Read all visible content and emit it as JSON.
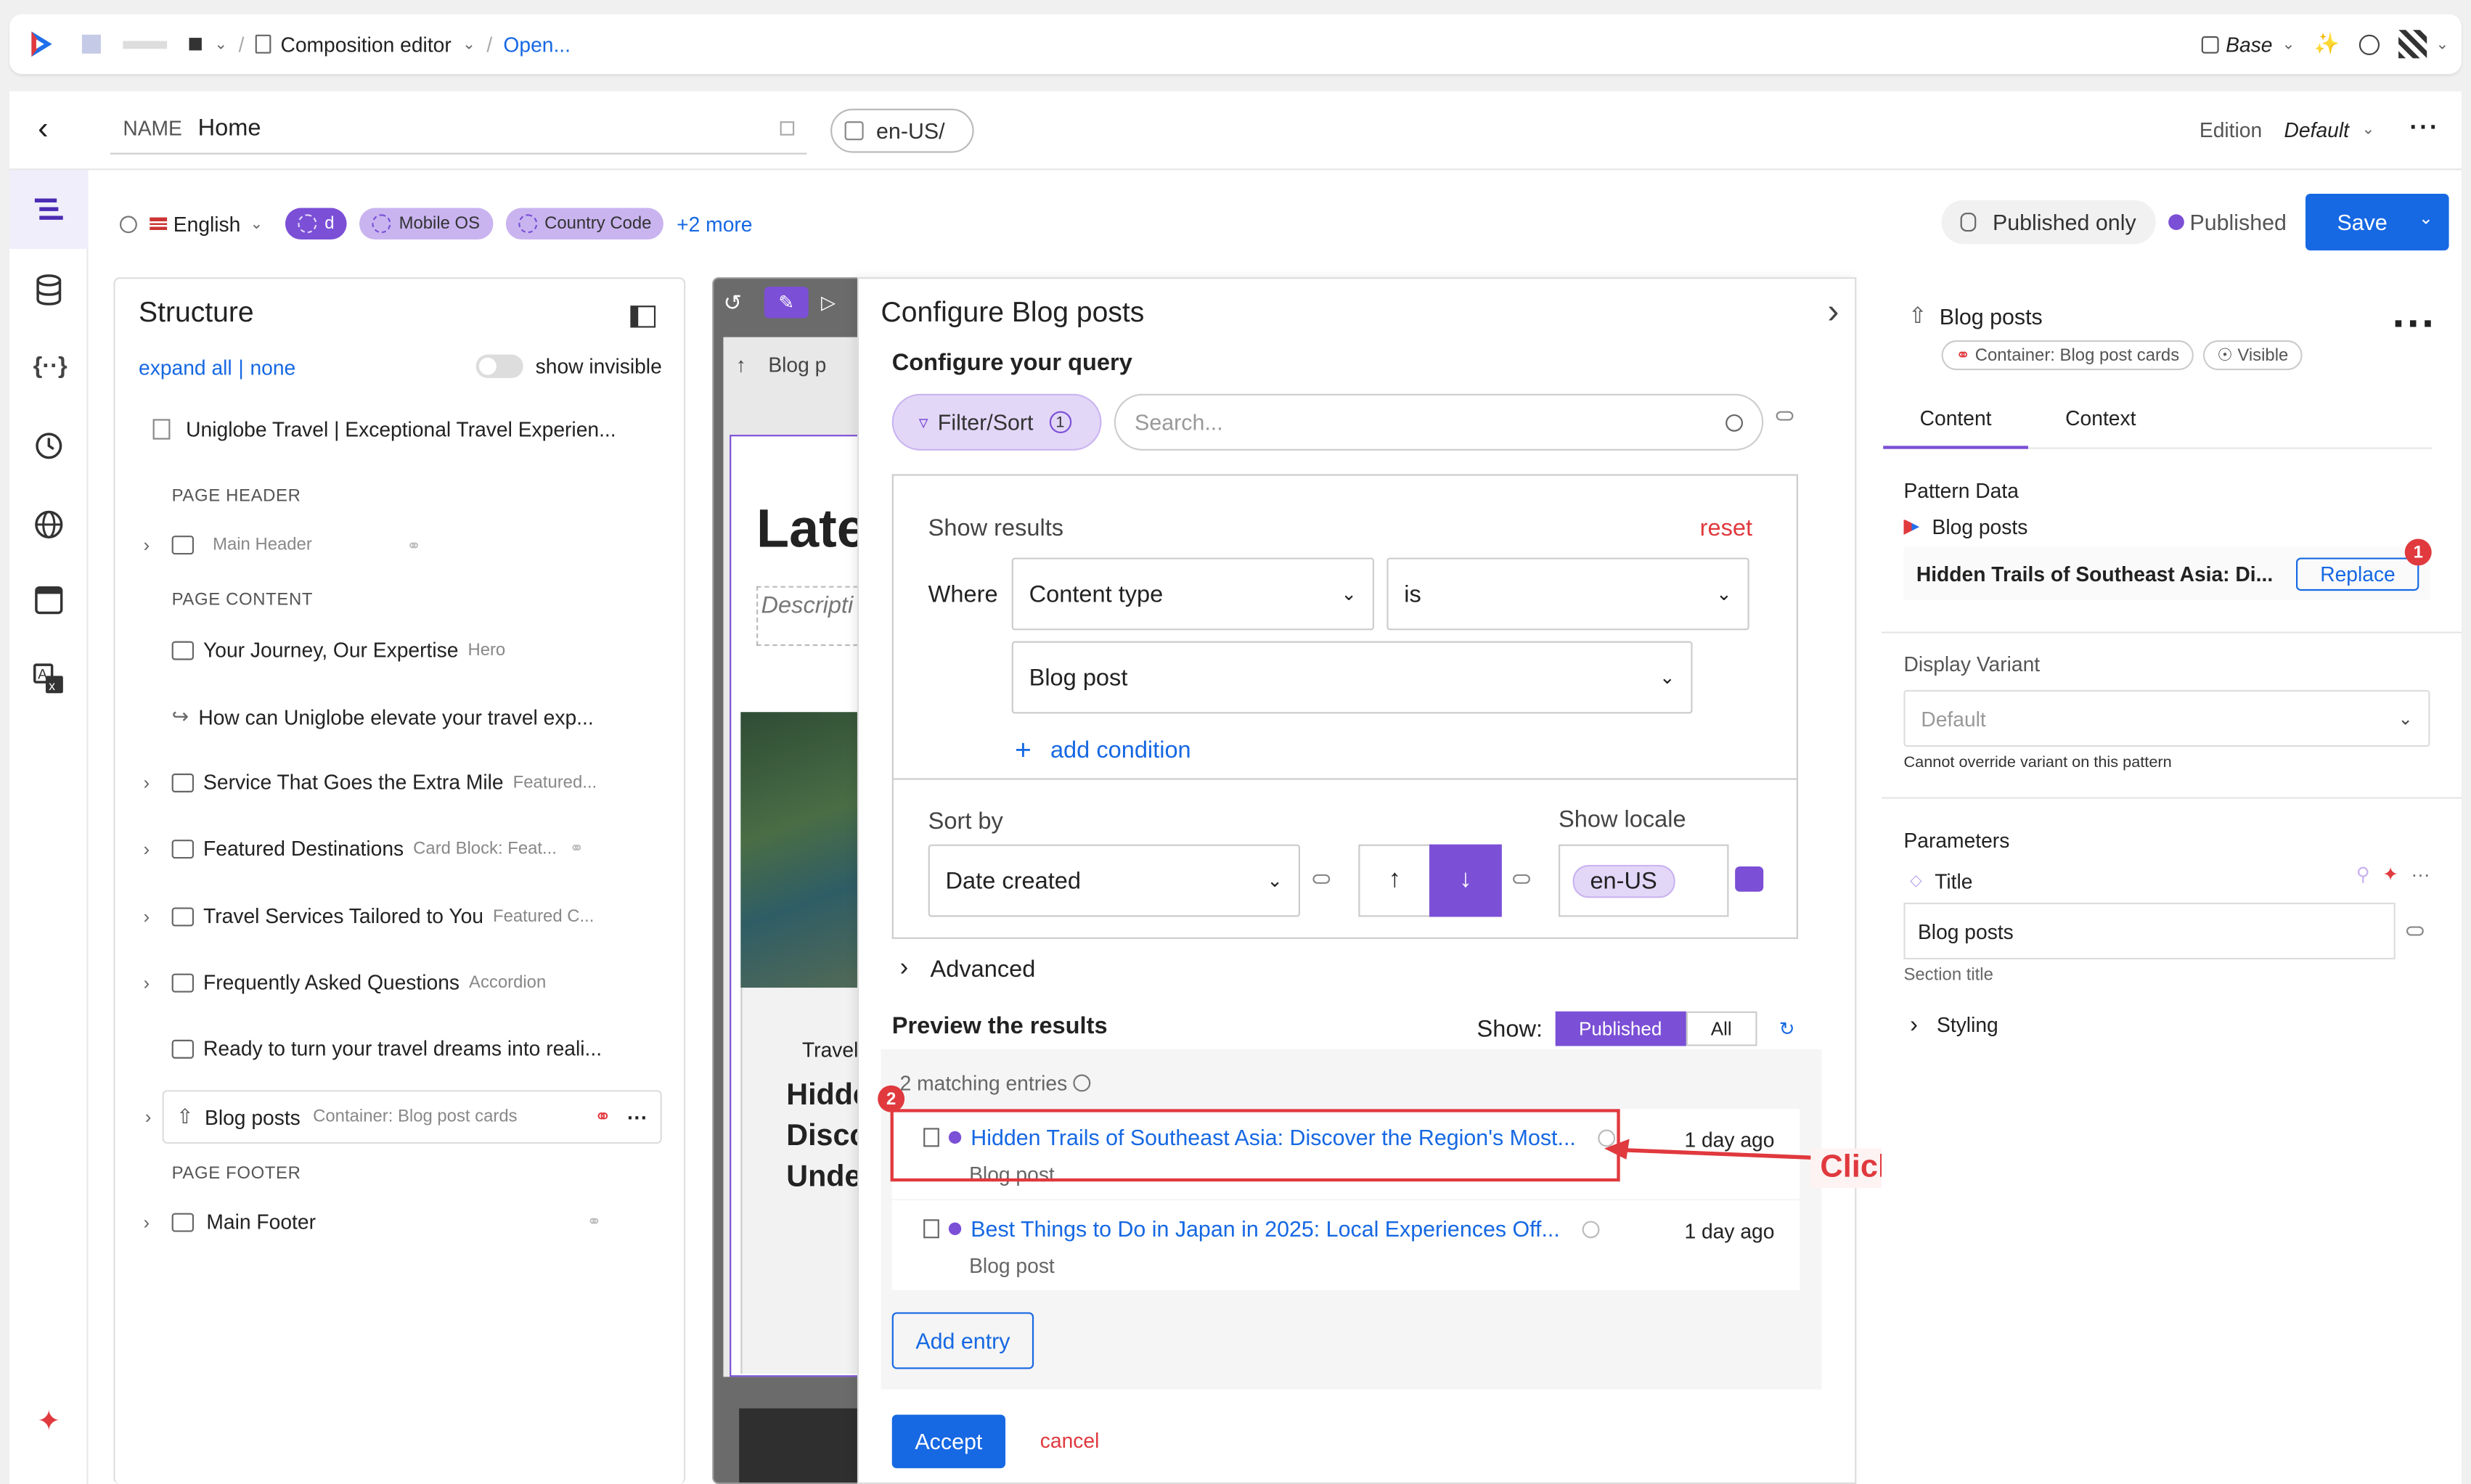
{
  "topbar": {
    "breadcrumb_editor": "Composition editor",
    "breadcrumb_open": "Open...",
    "base_label": "Base"
  },
  "header": {
    "name_label": "NAME",
    "name_value": "Home",
    "locale_path": "en-US/",
    "edition_label": "Edition",
    "edition_value": "Default"
  },
  "filters": {
    "language": "English",
    "chip_d": "d",
    "chip_mobile": "Mobile OS",
    "chip_country": "Country Code",
    "more": "+2 more",
    "published_only": "Published only",
    "status": "Published",
    "save": "Save"
  },
  "structure": {
    "title": "Structure",
    "expand_all": "expand all",
    "divider": "|",
    "none": "none",
    "show_invisible": "show invisible",
    "root_item": "Uniglobe Travel | Exceptional Travel Experien...",
    "page_header": "PAGE HEADER",
    "main_header": "Main Header",
    "page_content": "PAGE CONTENT",
    "items": [
      {
        "label": "Your Journey, Our Expertise",
        "sub": "Hero"
      },
      {
        "label": "How can Uniglobe elevate your travel exp...",
        "sub": ""
      },
      {
        "label": "Service That Goes the Extra Mile",
        "sub": "Featured..."
      },
      {
        "label": "Featured Destinations",
        "sub": "Card Block: Feat..."
      },
      {
        "label": "Travel Services Tailored to You",
        "sub": "Featured C..."
      },
      {
        "label": "Frequently Asked Questions",
        "sub": "Accordion"
      },
      {
        "label": "Ready to turn your travel dreams into reali...",
        "sub": ""
      },
      {
        "label": "Blog posts",
        "sub": "Container: Blog post cards"
      }
    ],
    "page_footer": "PAGE FOOTER",
    "main_footer": "Main Footer"
  },
  "canvas": {
    "blog_tab": "Blog p",
    "heading": "Late",
    "description": "Descripti",
    "card_tag": "Travel",
    "card_title_1": "Hidde",
    "card_title_2": "Disco",
    "card_title_3": "Unde"
  },
  "dialog": {
    "title": "Configure Blog posts",
    "query_heading": "Configure your query",
    "filter_btn": "Filter/Sort",
    "filter_count": "1",
    "search_placeholder": "Search...",
    "show_results": "Show results",
    "reset": "reset",
    "where": "Where",
    "field": "Content type",
    "operator": "is",
    "value": "Blog post",
    "add_condition": "add condition",
    "sort_by": "Sort by",
    "sort_field": "Date created",
    "show_locale": "Show locale",
    "locale_value": "en-US",
    "advanced": "Advanced",
    "preview_heading": "Preview the results",
    "show_label": "Show:",
    "show_published": "Published",
    "show_all": "All",
    "matching": "2 matching entries",
    "results": [
      {
        "title": "Hidden Trails of Southeast Asia: Discover the Region's Most...",
        "type": "Blog post",
        "time": "1 day ago"
      },
      {
        "title": "Best Things to Do in Japan in 2025: Local Experiences Off...",
        "type": "Blog post",
        "time": "1 day ago"
      }
    ],
    "add_entry": "Add entry",
    "accept": "Accept",
    "cancel": "cancel"
  },
  "annotation": {
    "badge_1": "1",
    "badge_2": "2",
    "callout": "Click to edit in nested editor"
  },
  "right_panel": {
    "title": "Blog posts",
    "chip_container": "Container: Blog post cards",
    "chip_visible": "Visible",
    "tab_content": "Content",
    "tab_context": "Context",
    "pattern_data": "Pattern Data",
    "pattern_name": "Blog posts",
    "pattern_entry": "Hidden Trails of Southeast Asia: Di...",
    "replace": "Replace",
    "display_variant": "Display Variant",
    "variant_value": "Default",
    "variant_note": "Cannot override variant on this pattern",
    "parameters": "Parameters",
    "param_title": "Title",
    "param_value": "Blog posts",
    "param_note": "Section title",
    "styling": "Styling"
  },
  "colors": {
    "accent_blue": "#1668e3",
    "purple": "#7b4fd6",
    "chip_purple": "#c9b4f0",
    "annotation_red": "#e0393e"
  }
}
